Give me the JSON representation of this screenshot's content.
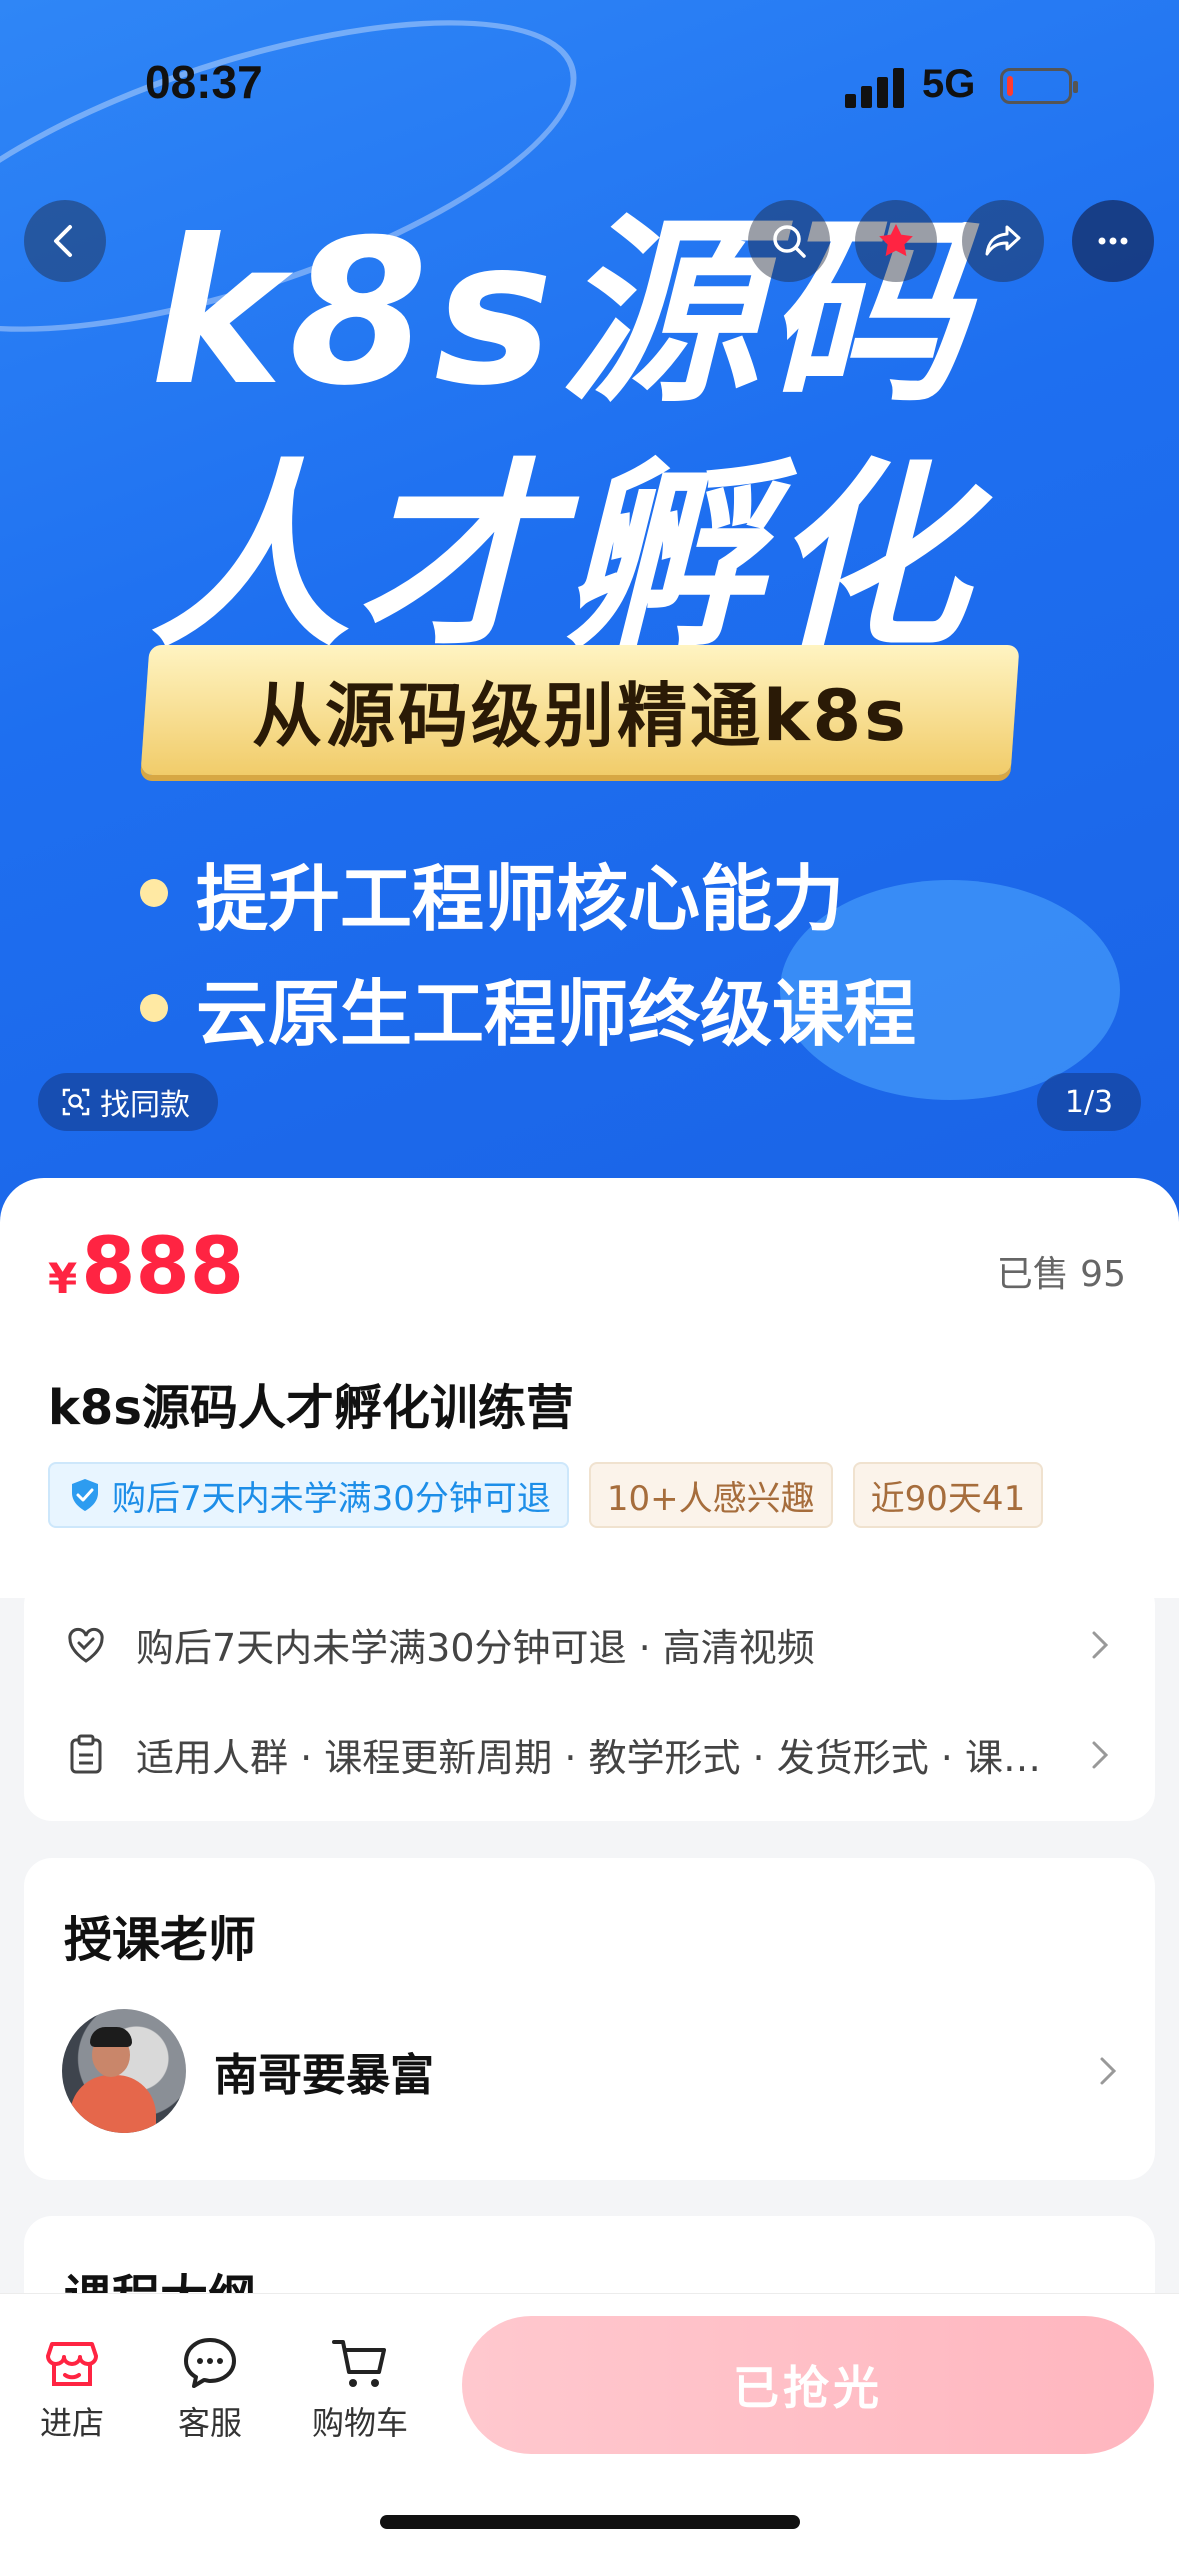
{
  "status_bar": {
    "time": "08:37",
    "network": "5G",
    "battery_level": 0.08
  },
  "hero": {
    "line1": "k8s源码",
    "line2": "人才孵化",
    "highlight": "从源码级别精通k8s",
    "bullets": [
      "提升工程师核心能力",
      "云原生工程师终级课程"
    ],
    "find_same_label": "找同款",
    "page_counter": "1/3"
  },
  "nav_icons": [
    "back-icon",
    "search-icon",
    "favorite-star-icon",
    "share-icon",
    "more-icon"
  ],
  "product": {
    "currency": "¥",
    "price": "888",
    "sold": "已售 95",
    "title": "k8s源码人才孵化训练营",
    "tags": [
      "购后7天内未学满30分钟可退",
      "10+人感兴趣",
      "近90天41"
    ]
  },
  "services": {
    "guarantee": "购后7天内未学满30分钟可退 · 高清视频",
    "params": "适用人群 · 课程更新周期 · 教学形式 · 发货形式 · 课程时长"
  },
  "teacher_section": {
    "title": "授课老师",
    "name": "南哥要暴富"
  },
  "outline_section": {
    "title": "课程大纲"
  },
  "bottom_bar": {
    "store": "进店",
    "service": "客服",
    "cart": "购物车",
    "sold_out": "已抢光"
  },
  "colors": {
    "price_red": "#ff2442",
    "hero_blue": "#1e6ff0",
    "sold_out_pink": "#ffb6bf"
  }
}
